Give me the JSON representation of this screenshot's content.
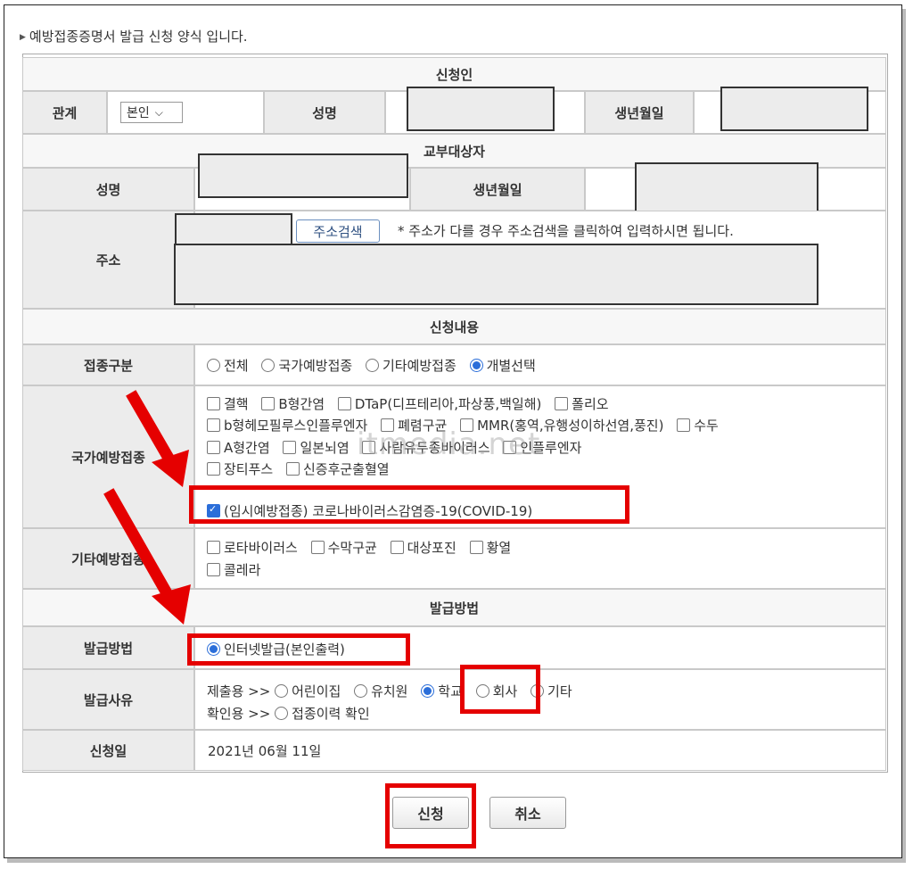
{
  "notice": "예방접종증명서 발급 신청 양식 입니다.",
  "sections": {
    "applicant": "신청인",
    "recipient": "교부대상자",
    "content": "신청내용",
    "issue": "발급방법"
  },
  "applicant": {
    "relation_label": "관계",
    "relation_value": "본인",
    "name_label": "성명",
    "birth_label": "생년월일"
  },
  "recipient": {
    "name_label": "성명",
    "birth_label": "생년월일",
    "address_label": "주소",
    "address_search_button": "주소검색",
    "address_hint": "* 주소가 다를 경우 주소검색을 클릭하여 입력하시면 됩니다."
  },
  "vaccination_type": {
    "label": "접종구분",
    "options": [
      "전체",
      "국가예방접종",
      "기타예방접종",
      "개별선택"
    ],
    "selected": "개별선택"
  },
  "national": {
    "label": "국가예방접종",
    "row1": [
      "결핵",
      "B형간염",
      "DTaP(디프테리아,파상풍,백일해)",
      "폴리오"
    ],
    "row2": [
      "b형헤모필루스인플루엔자",
      "폐렴구균",
      "MMR(홍역,유행성이하선염,풍진)",
      "수두"
    ],
    "row3": [
      "A형간염",
      "일본뇌염",
      "사람유두종바이러스",
      "인플루엔자"
    ],
    "row4": [
      "장티푸스",
      "신증후군출혈열"
    ],
    "covid": "(임시예방접종) 코로나바이러스감염증-19(COVID-19)"
  },
  "other": {
    "label": "기타예방접종",
    "row1": [
      "로타바이러스",
      "수막구균",
      "대상포진",
      "황열"
    ],
    "row2": [
      "콜레라"
    ]
  },
  "issue_method": {
    "label": "발급방법",
    "value": "인터넷발급(본인출력)"
  },
  "issue_reason": {
    "label": "발급사유",
    "submit_prefix": "제출용 >>",
    "submit_options": [
      "어린이집",
      "유치원",
      "학교",
      "회사",
      "기타"
    ],
    "selected": "학교",
    "confirm_prefix": "확인용 >>",
    "confirm_option": "접종이력 확인"
  },
  "apply_date": {
    "label": "신청일",
    "value": "2021년 06월 11일"
  },
  "buttons": {
    "submit": "신청",
    "cancel": "취소"
  },
  "watermark": "itmedia.net",
  "colors": {
    "highlight": "#e50000",
    "accent": "#2b6ed9"
  }
}
